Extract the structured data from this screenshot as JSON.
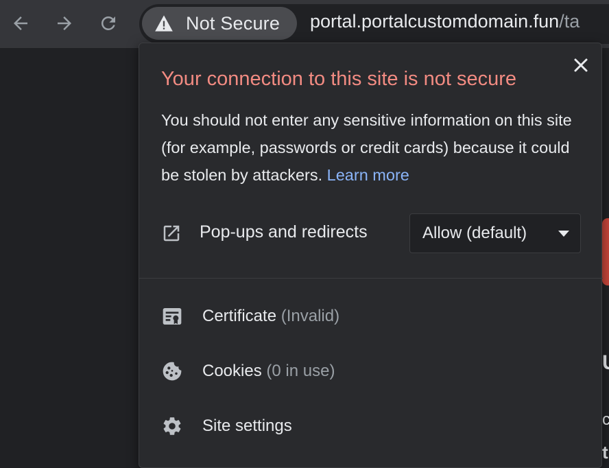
{
  "browser": {
    "security_chip_label": "Not Secure",
    "url_domain": "portal.portalcustomdomain.fun",
    "url_path": "/ta"
  },
  "page_peek": {
    "letter_1": "U",
    "letter_2": "c",
    "letter_3": "t"
  },
  "popup": {
    "title": "Your connection to this site is not secure",
    "description": "You should not enter any sensitive information on this site (for example, passwords or credit cards) because it could be stolen by attackers.",
    "learn_more": "Learn more",
    "permission": {
      "label": "Pop-ups and redirects",
      "selected": "Allow (default)"
    },
    "items": [
      {
        "label": "Certificate",
        "sub": "(Invalid)",
        "icon": "certificate-icon"
      },
      {
        "label": "Cookies",
        "sub": "(0 in use)",
        "icon": "cookie-icon"
      },
      {
        "label": "Site settings",
        "sub": "",
        "icon": "gear-icon"
      }
    ]
  },
  "colors": {
    "toolbar": "#35363a",
    "popup_bg": "#292a2d",
    "warning_title": "#f28b82",
    "link": "#8ab4f8",
    "page_accent": "#c5453a"
  }
}
